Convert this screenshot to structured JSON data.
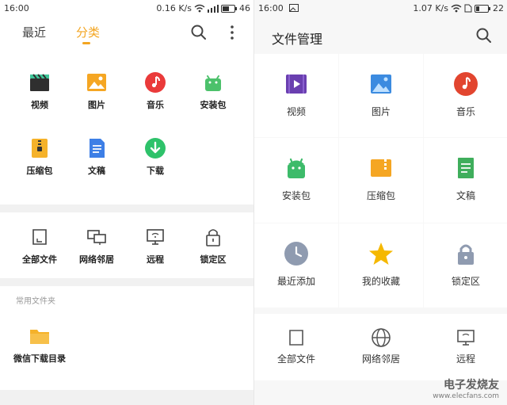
{
  "left": {
    "status": {
      "time": "16:00",
      "speed": "0.16 K/s",
      "battery": "46"
    },
    "tabs": {
      "recent": "最近",
      "category": "分类"
    },
    "categories": [
      {
        "label": "视频",
        "icon": "clapper-icon",
        "color": "#2f2f2f"
      },
      {
        "label": "图片",
        "icon": "image-icon",
        "color": "#f5a623"
      },
      {
        "label": "音乐",
        "icon": "music-icon",
        "color": "#ea3a3a"
      },
      {
        "label": "安装包",
        "icon": "android-icon",
        "color": "#4cc16b"
      },
      {
        "label": "压缩包",
        "icon": "archive-icon",
        "color": "#f5b22a"
      },
      {
        "label": "文稿",
        "icon": "document-icon",
        "color": "#3d7fe6"
      },
      {
        "label": "下载",
        "icon": "download-icon",
        "color": "#2ec26a"
      }
    ],
    "tools": [
      {
        "label": "全部文件",
        "icon": "sdcard-icon"
      },
      {
        "label": "网络邻居",
        "icon": "network-icon"
      },
      {
        "label": "远程",
        "icon": "remote-icon"
      },
      {
        "label": "锁定区",
        "icon": "lock-icon"
      }
    ],
    "section_title": "常用文件夹",
    "folders": [
      {
        "label": "微信下载目录",
        "icon": "folder-icon",
        "color": "#f5b22a"
      }
    ]
  },
  "right": {
    "status": {
      "time": "16:00",
      "speed": "1.07 K/s",
      "battery": "22"
    },
    "title": "文件管理",
    "grid": [
      {
        "label": "视频",
        "icon": "video-icon",
        "color": "#6a3fb0"
      },
      {
        "label": "图片",
        "icon": "image-icon",
        "color": "#3c8be0"
      },
      {
        "label": "音乐",
        "icon": "music-icon",
        "color": "#e2452f"
      },
      {
        "label": "安装包",
        "icon": "android-icon",
        "color": "#3dbb6a"
      },
      {
        "label": "压缩包",
        "icon": "archive-icon",
        "color": "#f5a623"
      },
      {
        "label": "文稿",
        "icon": "document-icon",
        "color": "#3fae5c"
      },
      {
        "label": "最近添加",
        "icon": "clock-icon",
        "color": "#8f9bb0"
      },
      {
        "label": "我的收藏",
        "icon": "star-icon",
        "color": "#f5b800"
      },
      {
        "label": "锁定区",
        "icon": "lock-icon",
        "color": "#8f9bb0"
      }
    ],
    "tools": [
      {
        "label": "全部文件",
        "icon": "sdcard-icon"
      },
      {
        "label": "网络邻居",
        "icon": "globe-icon"
      },
      {
        "label": "远程",
        "icon": "remote-icon"
      }
    ],
    "watermark": "电子发烧友",
    "watermark_url": "www.elecfans.com"
  }
}
